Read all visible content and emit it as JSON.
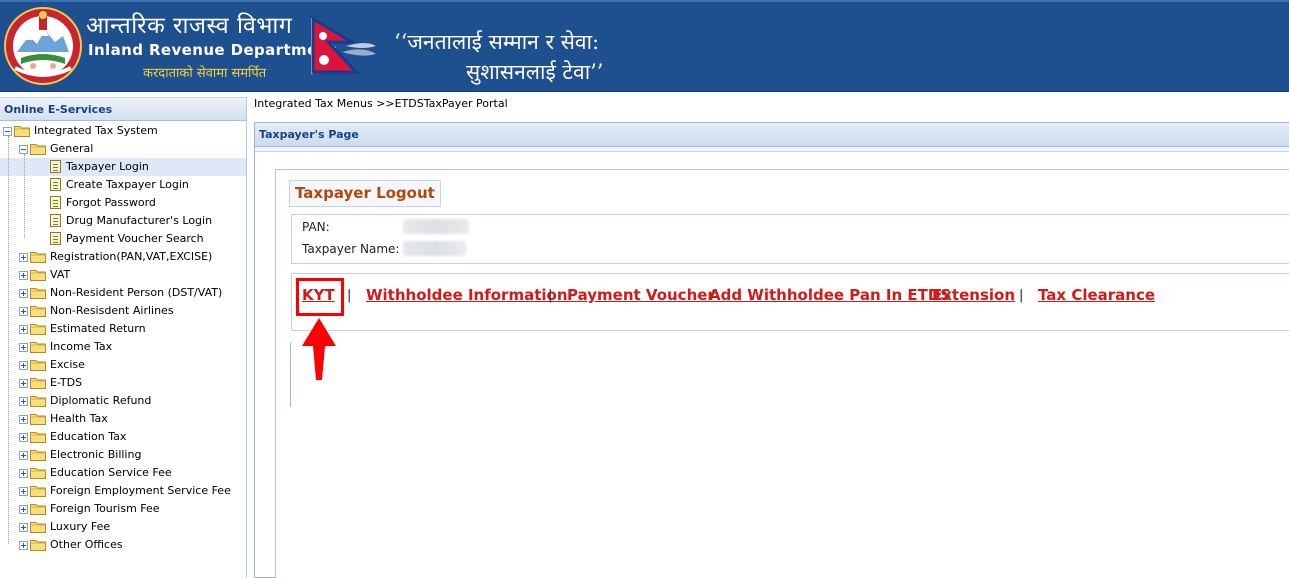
{
  "header": {
    "title_np": "आन्तरिक राजस्व विभाग",
    "title_en": "Inland Revenue Department",
    "tagline_np": "करदाताको सेवामा समर्पित",
    "quote_line1": "‘‘जनतालाई सम्मान र सेवा:",
    "quote_line2": "सुशासनलाई टेवा’’"
  },
  "sidebar": {
    "title": "Online E-Services",
    "root": "Integrated Tax System",
    "general": {
      "label": "General",
      "children": [
        "Taxpayer Login",
        "Create Taxpayer Login",
        "Forgot Password",
        "Drug Manufacturer's Login",
        "Payment Voucher Search"
      ],
      "selected_index": 0
    },
    "folders": [
      "Registration(PAN,VAT,EXCISE)",
      "VAT",
      "Non-Resident Person (DST/VAT)",
      "Non-Resisdent Airlines",
      "Estimated Return",
      "Income Tax",
      "Excise",
      "E-TDS",
      "Diplomatic Refund",
      "Health Tax",
      "Education Tax",
      "Electronic Billing",
      "Education Service Fee",
      "Foreign Employment Service Fee",
      "Foreign Tourism Fee",
      "Luxury Fee",
      "Other Offices"
    ]
  },
  "breadcrumb": "Integrated Tax Menus >>ETDSTaxPayer Portal",
  "panel": {
    "title": "Taxpayer's Page",
    "logout_title": "Taxpayer Logout",
    "pan_label": "PAN:",
    "name_label": "Taxpayer Name:"
  },
  "links": {
    "kyt": "KYT",
    "withholdee_info": "Withholdee Information",
    "payment_voucher": "Payment Voucher",
    "add_withholdee_pan": "Add Withholdee Pan In ETDS",
    "extension": "Extension",
    "tax_clearance": "Tax Clearance",
    "separator": "|"
  },
  "colors": {
    "header_bg": "#1e4f8e",
    "link_red": "#d11a1a",
    "logout_orange": "#b04a0c",
    "annotation_red": "#ff0000"
  }
}
